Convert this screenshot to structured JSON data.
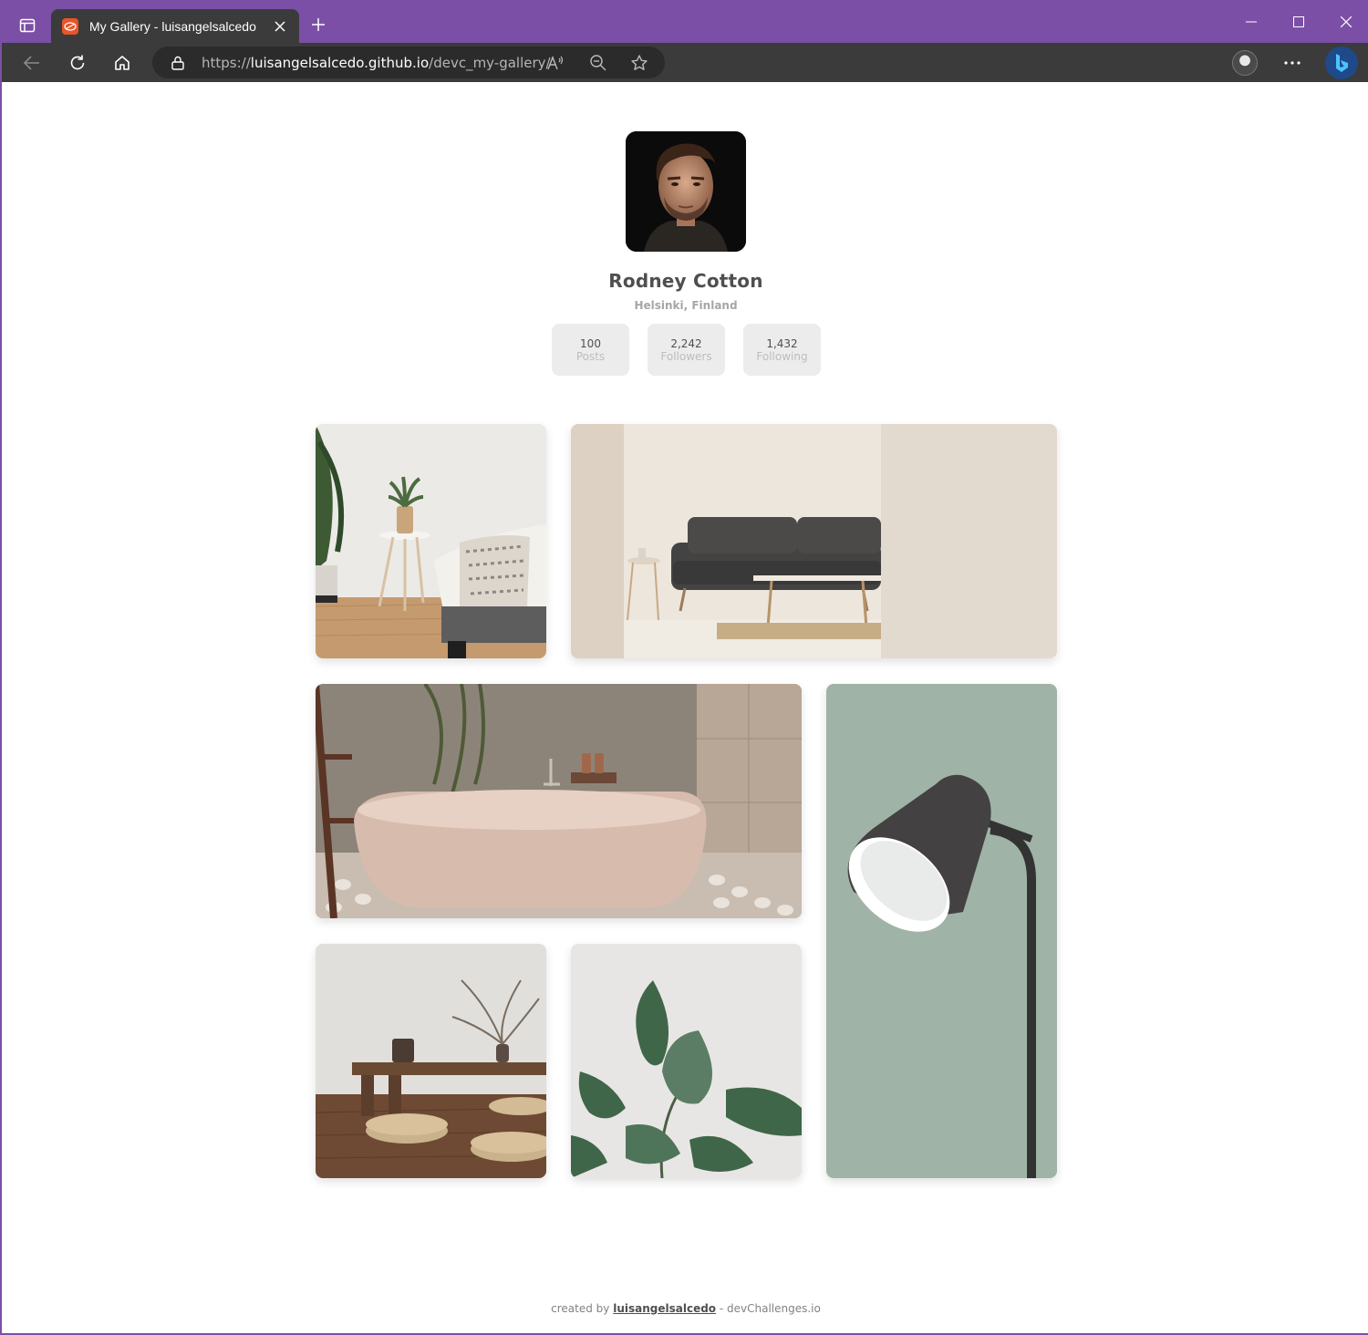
{
  "browser": {
    "tab_title": "My Gallery - luisangelsalcedo",
    "url_scheme": "https://",
    "url_domain": "luisangelsalcedo.github.io",
    "url_path": "/devc_my-gallery/"
  },
  "profile": {
    "name": "Rodney Cotton",
    "location": "Helsinki, Finland",
    "stats": [
      {
        "value": "100",
        "label": "Posts"
      },
      {
        "value": "2,242",
        "label": "Followers"
      },
      {
        "value": "1,432",
        "label": "Following"
      }
    ]
  },
  "gallery": {
    "photos": [
      {
        "subject": "bedroom-side-table-plant"
      },
      {
        "subject": "living-room-sofa"
      },
      {
        "subject": "bathtub"
      },
      {
        "subject": "floor-lamp"
      },
      {
        "subject": "low-table-floor-cushions"
      },
      {
        "subject": "rubber-plant"
      }
    ]
  },
  "footer": {
    "prefix": "created by",
    "author": "luisangelsalcedo",
    "suffix": "- devChallenges.io"
  },
  "colors": {
    "titlebar": "#7b4fa6",
    "toolbar": "#3b3b3b",
    "stat_bg": "#ececec",
    "text_primary": "#4f4f4f",
    "text_muted": "#bdbdbd"
  }
}
